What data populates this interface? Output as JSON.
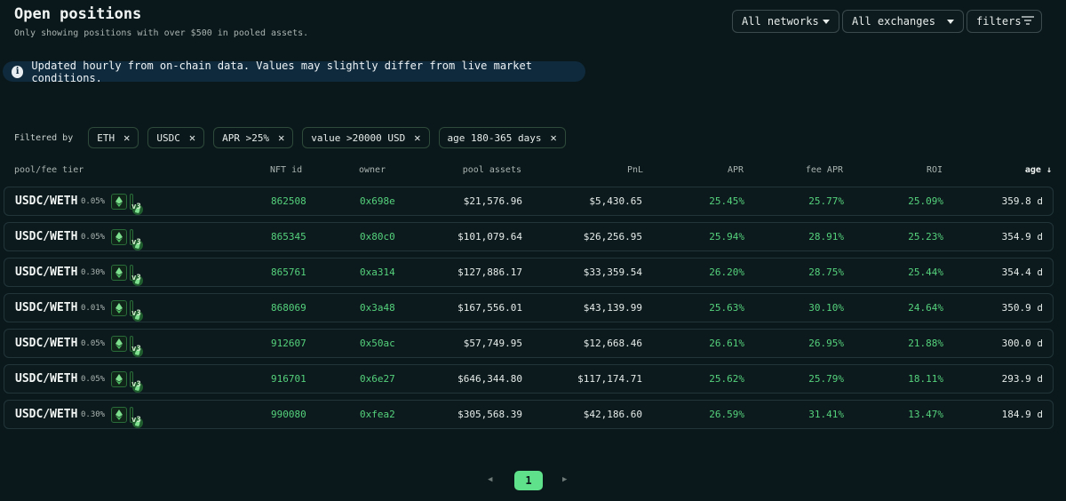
{
  "header": {
    "title": "Open positions",
    "subtitle": "Only showing positions with over $500 in pooled assets."
  },
  "controls": {
    "networks": "All networks",
    "exchanges": "All exchanges",
    "filters": "filters"
  },
  "info": {
    "icon": "info-icon",
    "text": "Updated hourly from on-chain data. Values may slightly differ from live market conditions."
  },
  "filter_bar": {
    "label": "Filtered by",
    "chips": [
      "ETH",
      "USDC",
      "APR >25%",
      "value >20000 USD",
      "age 180-365 days"
    ]
  },
  "table": {
    "columns": [
      "pool/fee tier",
      "NFT id",
      "owner",
      "pool assets",
      "PnL",
      "APR",
      "fee APR",
      "ROI",
      "age ↓"
    ],
    "rows": [
      {
        "pair": "USDC/WETH",
        "fee": "0.05%",
        "version": "v3",
        "nft": "862508",
        "owner": "0x698e",
        "pool": "$21,576.96",
        "pnl": "$5,430.65",
        "apr": "25.45%",
        "fee_apr": "25.77%",
        "roi": "25.09%",
        "age": "359.8 d"
      },
      {
        "pair": "USDC/WETH",
        "fee": "0.05%",
        "version": "v3",
        "nft": "865345",
        "owner": "0x80c0",
        "pool": "$101,079.64",
        "pnl": "$26,256.95",
        "apr": "25.94%",
        "fee_apr": "28.91%",
        "roi": "25.23%",
        "age": "354.9 d"
      },
      {
        "pair": "USDC/WETH",
        "fee": "0.30%",
        "version": "v3",
        "nft": "865761",
        "owner": "0xa314",
        "pool": "$127,886.17",
        "pnl": "$33,359.54",
        "apr": "26.20%",
        "fee_apr": "28.75%",
        "roi": "25.44%",
        "age": "354.4 d"
      },
      {
        "pair": "USDC/WETH",
        "fee": "0.01%",
        "version": "v3",
        "nft": "868069",
        "owner": "0x3a48",
        "pool": "$167,556.01",
        "pnl": "$43,139.99",
        "apr": "25.63%",
        "fee_apr": "30.10%",
        "roi": "24.64%",
        "age": "350.9 d"
      },
      {
        "pair": "USDC/WETH",
        "fee": "0.05%",
        "version": "v3",
        "nft": "912607",
        "owner": "0x50ac",
        "pool": "$57,749.95",
        "pnl": "$12,668.46",
        "apr": "26.61%",
        "fee_apr": "26.95%",
        "roi": "21.88%",
        "age": "300.0 d"
      },
      {
        "pair": "USDC/WETH",
        "fee": "0.05%",
        "version": "v3",
        "nft": "916701",
        "owner": "0x6e27",
        "pool": "$646,344.80",
        "pnl": "$117,174.71",
        "apr": "25.62%",
        "fee_apr": "25.79%",
        "roi": "18.11%",
        "age": "293.9 d"
      },
      {
        "pair": "USDC/WETH",
        "fee": "0.30%",
        "version": "v3",
        "nft": "990080",
        "owner": "0xfea2",
        "pool": "$305,568.39",
        "pnl": "$42,186.60",
        "apr": "26.59%",
        "fee_apr": "31.41%",
        "roi": "13.47%",
        "age": "184.9 d"
      }
    ]
  },
  "pagination": {
    "prev": "◀",
    "current": "1",
    "next": "▶"
  },
  "colors": {
    "background": "#0b181b",
    "accent_green": "#55d27c",
    "page_active": "#5fe08a",
    "info_bg": "#0f2a3c"
  }
}
